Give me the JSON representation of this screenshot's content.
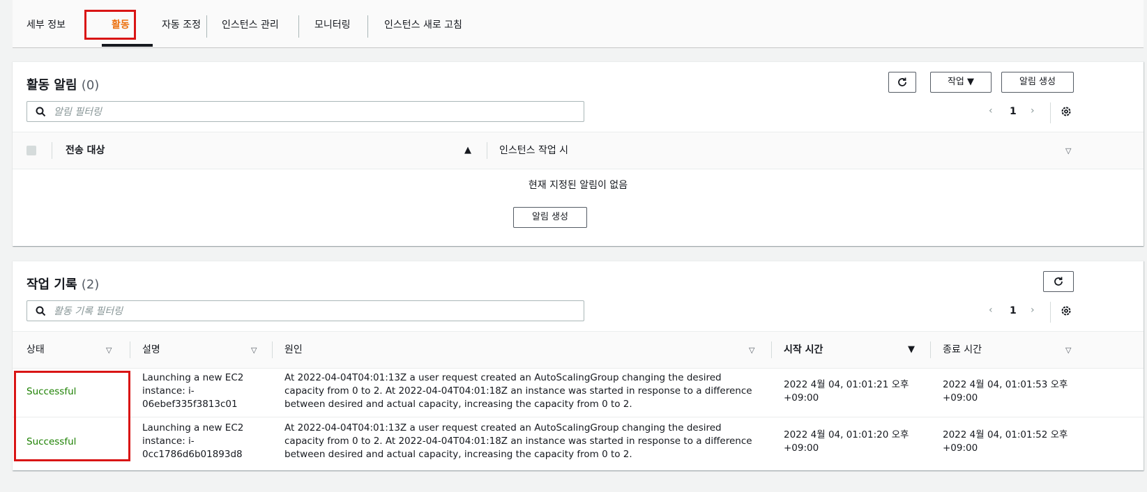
{
  "tabs": [
    {
      "label": "세부 정보"
    },
    {
      "label": "활동"
    },
    {
      "label": "자동 조정"
    },
    {
      "label": "인스턴스 관리"
    },
    {
      "label": "모니터링"
    },
    {
      "label": "인스턴스 새로 고침"
    }
  ],
  "notifications": {
    "title": "활동 알림",
    "count": "(0)",
    "refresh_icon": "refresh-icon",
    "actions_label": "작업 ▼",
    "create_label": "알림 생성",
    "search_placeholder": "알림 필터링",
    "page": "1",
    "columns": [
      "전송 대상",
      "인스턴스 작업 시"
    ],
    "empty_text": "현재 지정된 알림이 없음",
    "empty_create_label": "알림 생성"
  },
  "history": {
    "title": "작업 기록",
    "count": "(2)",
    "search_placeholder": "활동 기록 필터링",
    "page": "1",
    "columns": [
      "상태",
      "설명",
      "원인",
      "시작 시간",
      "종료 시간"
    ],
    "rows": [
      {
        "status": "Successful",
        "description": "Launching a new EC2 instance: i-06ebef335f3813c01",
        "cause": "At 2022-04-04T04:01:13Z a user request created an AutoScalingGroup changing the desired capacity from 0 to 2. At 2022-04-04T04:01:18Z an instance was started in response to a difference between desired and actual capacity, increasing the capacity from 0 to 2.",
        "start": "2022 4월 04, 01:01:21 오후 +09:00",
        "end": "2022 4월 04, 01:01:53 오후 +09:00"
      },
      {
        "status": "Successful",
        "description": "Launching a new EC2 instance: i-0cc1786d6b01893d8",
        "cause": "At 2022-04-04T04:01:13Z a user request created an AutoScalingGroup changing the desired capacity from 0 to 2. At 2022-04-04T04:01:18Z an instance was started in response to a difference between desired and actual capacity, increasing the capacity from 0 to 2.",
        "start": "2022 4월 04, 01:01:20 오후 +09:00",
        "end": "2022 4월 04, 01:01:52 오후 +09:00"
      }
    ]
  },
  "colors": {
    "accent": "#ec7211",
    "highlight_box": "#d91515",
    "success": "#1d8102"
  }
}
